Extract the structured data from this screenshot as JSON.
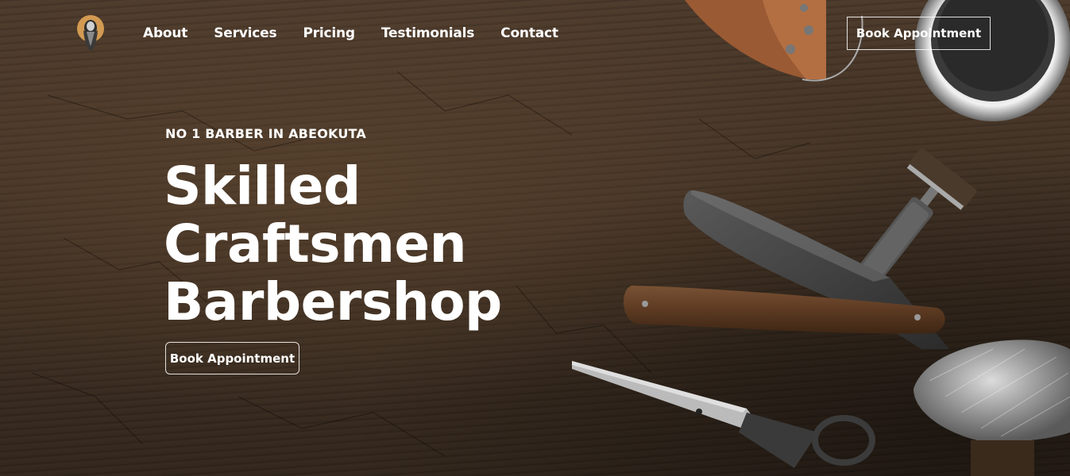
{
  "nav": {
    "logo_icon": "bearded-barber-logo-icon",
    "links": [
      "About",
      "Services",
      "Pricing",
      "Testimonials",
      "Contact"
    ],
    "cta_label": "Book Appointment"
  },
  "hero": {
    "eyebrow": "NO 1 BARBER IN ABEOKUTA",
    "headline": [
      "Skilled",
      "Craftsmen",
      "Barbershop"
    ],
    "cta_label": "Book Appointment"
  },
  "images": {
    "background": "dark-wood-texture-with-barber-tools",
    "tools": [
      "leather-strop",
      "metal-shaving-bowl",
      "safety-razor",
      "straight-razor",
      "scissors",
      "shaving-brush"
    ]
  },
  "colors": {
    "wood_dark": "#3e2f22",
    "logo_accent": "#d39a52",
    "text": "#ffffff"
  }
}
